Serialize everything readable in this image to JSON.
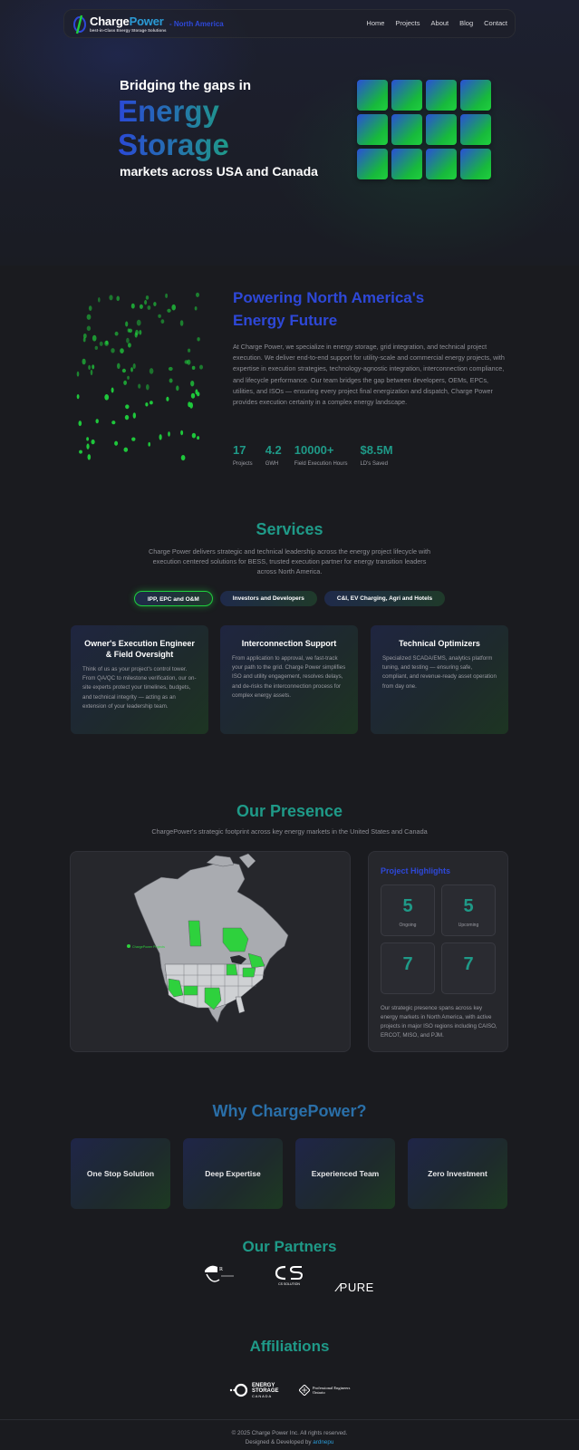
{
  "nav": {
    "brand_charge": "Charge",
    "brand_power": "Power",
    "tagline": "best-in-Class Energy Storage Solutions",
    "region": "- North America",
    "links": [
      "Home",
      "Projects",
      "About",
      "Blog",
      "Contact"
    ]
  },
  "hero": {
    "line1": "Bridging the gaps in",
    "line2": "Energy",
    "line3": "Storage",
    "line4": "markets across USA and Canada"
  },
  "about": {
    "heading1": "Powering North America's",
    "heading2": "Energy Future",
    "body": "At Charge Power, we specialize in energy storage, grid integration, and technical project execution. We deliver end-to-end support for utility-scale and commercial energy projects, with expertise in execution strategies, technology-agnostic integration, interconnection compliance, and lifecycle performance. Our team bridges the gap between developers, OEMs, EPCs, utilities, and ISOs — ensuring every project final energization and dispatch, Charge Power provides execution certainty in a complex energy landscape.",
    "stats": [
      {
        "value": "17",
        "label": "Projects"
      },
      {
        "value": "4.2",
        "label": "GWH"
      },
      {
        "value": "10000+",
        "label": "Field Execution Hours"
      },
      {
        "value": "$8.5M",
        "label": "LD's Saved"
      }
    ]
  },
  "services": {
    "title": "Services",
    "subtitle": "Charge Power delivers strategic and technical leadership across the energy project lifecycle with execution centered solutions for BESS, trusted execution partner for energy transition leaders across North America.",
    "tabs": [
      "IPP, EPC and O&M",
      "Investors and Developers",
      "C&I, EV Charging, Agri and Hotels"
    ],
    "cards": [
      {
        "title": "Owner's Execution Engineer & Field Oversight",
        "desc": "Think of us as your project's control tower. From QA/QC to milestone verification, our on-site experts protect your timelines, budgets, and technical integrity — acting as an extension of your leadership team."
      },
      {
        "title": "Interconnection Support",
        "desc": "From application to approval, we fast-track your path to the grid. Charge Power simplifies ISO and utility engagement, resolves delays, and de-risks the interconnection process for complex energy assets."
      },
      {
        "title": "Technical Optimizers",
        "desc": "Specialized SCADA/EMS, analytics platform tuning, and testing — ensuring safe, compliant, and revenue-ready asset operation from day one."
      }
    ]
  },
  "presence": {
    "title": "Our Presence",
    "subtitle": "ChargePower's strategic footprint across key energy markets in the United States and Canada",
    "map_legend": "ChargePower Projects",
    "highlights_title": "Project Highlights",
    "highlights": [
      {
        "value": "5",
        "label": "Ongoing"
      },
      {
        "value": "5",
        "label": "Upcoming"
      },
      {
        "value": "7",
        "label": ""
      },
      {
        "value": "7",
        "label": ""
      }
    ],
    "note": "Our strategic presence spans across key energy markets in North America, with active projects in major ISO regions including CAISO, ERCOT, MISO, and PJM."
  },
  "why": {
    "title": "Why ChargePower?",
    "items": [
      "One Stop Solution",
      "Deep Expertise",
      "Experienced Team",
      "Zero Investment"
    ]
  },
  "partners": {
    "title": "Our Partners",
    "logos": [
      "Renewable logo",
      "CS Solution",
      "PURE"
    ],
    "cs_caption": "CS SOLUTION",
    "pure_text": "PURE"
  },
  "affiliations": {
    "title": "Affiliations",
    "esc_line1": "ENERGY",
    "esc_line2": "STORAGE",
    "esc_line3": "C A N A D A",
    "pe_line1": "Professional Engineers",
    "pe_line2": "Ontario"
  },
  "footer": {
    "copyright": "© 2025 Charge Power Inc. All rights reserved.",
    "designed_by": "Designed & Developed by",
    "designer": "ardnepu"
  },
  "colors": {
    "accent_blue": "#2e48d8",
    "accent_teal": "#1f9a88",
    "accent_green": "#1fd13d",
    "background": "#1a1b1f"
  }
}
